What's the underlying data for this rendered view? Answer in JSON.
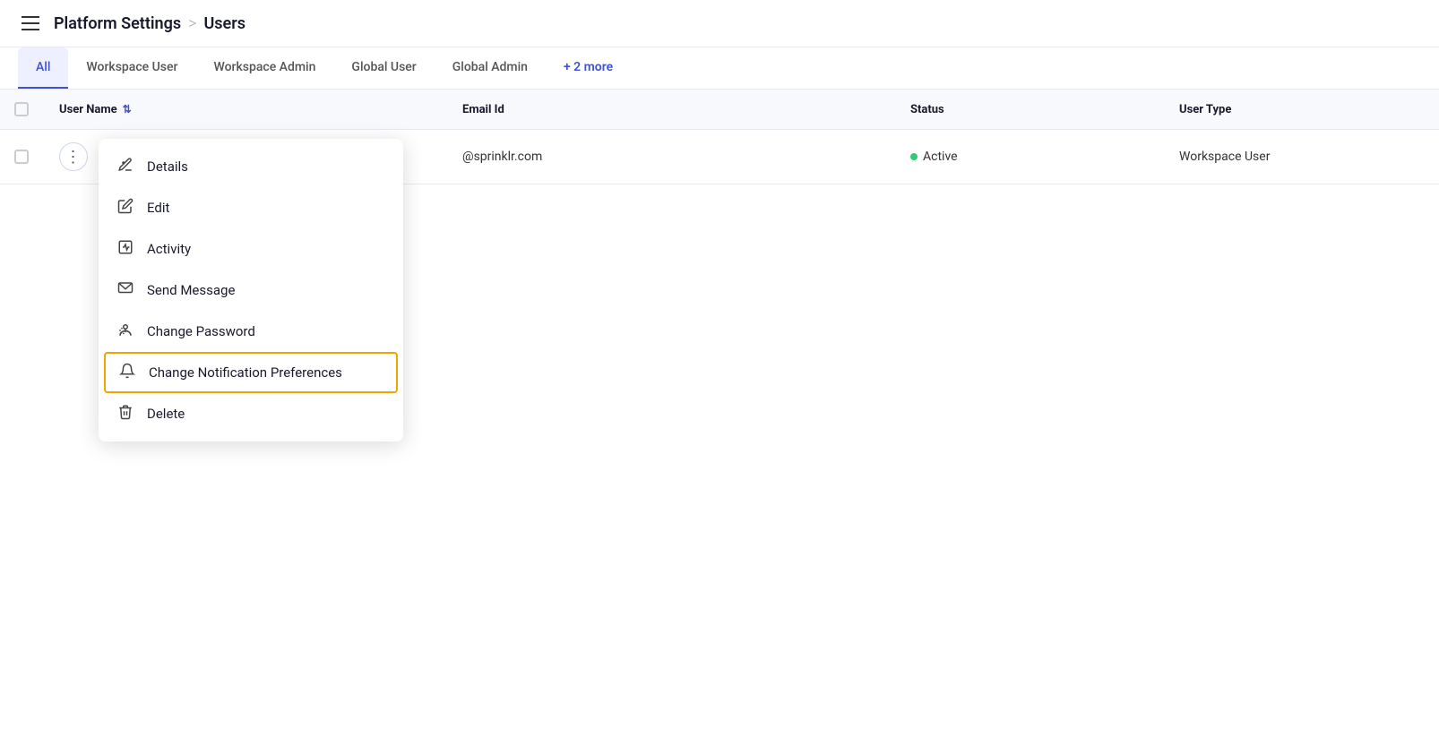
{
  "header": {
    "breadcrumb_part1": "Platform Settings",
    "breadcrumb_separator": ">",
    "breadcrumb_part2": "Users"
  },
  "tabs": {
    "items": [
      {
        "id": "all",
        "label": "All",
        "active": true
      },
      {
        "id": "workspace-user",
        "label": "Workspace User",
        "active": false
      },
      {
        "id": "workspace-admin",
        "label": "Workspace Admin",
        "active": false
      },
      {
        "id": "global-user",
        "label": "Global User",
        "active": false
      },
      {
        "id": "global-admin",
        "label": "Global Admin",
        "active": false
      },
      {
        "id": "more",
        "label": "+ 2 more",
        "active": false
      }
    ]
  },
  "table": {
    "columns": [
      {
        "id": "select",
        "label": ""
      },
      {
        "id": "username",
        "label": "User Name",
        "sortable": true
      },
      {
        "id": "email",
        "label": "Email Id"
      },
      {
        "id": "status",
        "label": "Status"
      },
      {
        "id": "usertype",
        "label": "User Type"
      }
    ],
    "rows": [
      {
        "email_partial": "@sprinklr.com",
        "status": "Active",
        "user_type": "Workspace User"
      }
    ]
  },
  "context_menu": {
    "items": [
      {
        "id": "details",
        "label": "Details",
        "icon": "details"
      },
      {
        "id": "edit",
        "label": "Edit",
        "icon": "edit"
      },
      {
        "id": "activity",
        "label": "Activity",
        "icon": "activity"
      },
      {
        "id": "send-message",
        "label": "Send Message",
        "icon": "message"
      },
      {
        "id": "change-password",
        "label": "Change Password",
        "icon": "password"
      },
      {
        "id": "change-notification",
        "label": "Change Notification Preferences",
        "icon": "bell",
        "highlighted": true
      },
      {
        "id": "delete",
        "label": "Delete",
        "icon": "trash"
      }
    ]
  },
  "colors": {
    "active_tab_bg": "#eef0ff",
    "active_tab_text": "#3d52d5",
    "more_link": "#3d52d5",
    "highlight_border": "#f0a500",
    "status_green": "#2ecc71"
  }
}
